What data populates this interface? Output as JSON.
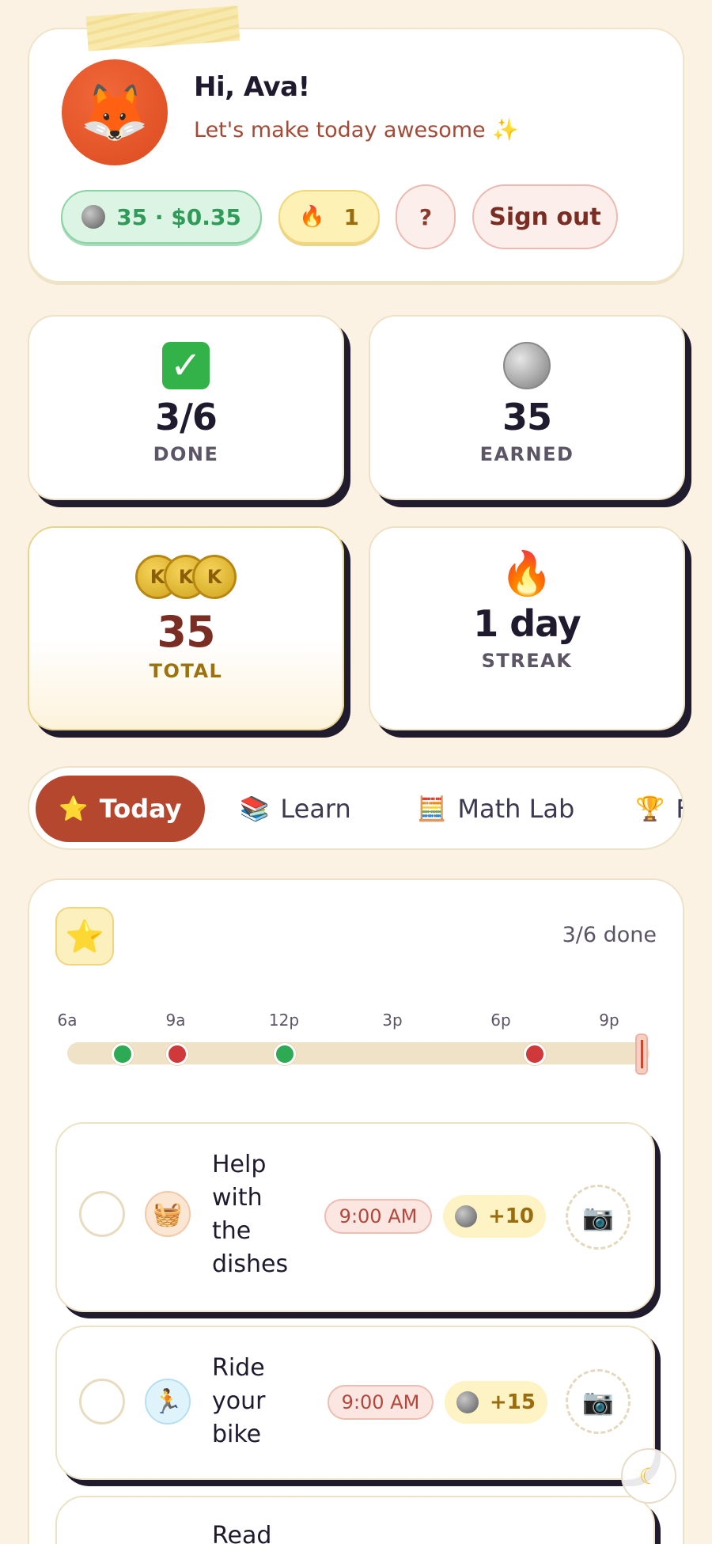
{
  "header": {
    "avatar_emoji": "🦊",
    "greeting": "Hi, Ava!",
    "subtitle": "Let's make today awesome ✨",
    "coins_pill": "35 · $0.35",
    "streak_pill_icon": "🔥",
    "streak_pill": "1",
    "help_label": "?",
    "signout_label": "Sign out"
  },
  "stats": {
    "done": {
      "value": "3/6",
      "label": "DONE"
    },
    "earned": {
      "value": "35",
      "label": "EARNED"
    },
    "total": {
      "value": "35",
      "label": "TOTAL",
      "coin_letters": [
        "K",
        "K",
        "K"
      ]
    },
    "streak": {
      "icon": "🔥",
      "value": "1 day",
      "label": "STREAK"
    }
  },
  "tabs": [
    {
      "icon": "⭐",
      "label": "Today",
      "active": true
    },
    {
      "icon": "📚",
      "label": "Learn"
    },
    {
      "icon": "🧮",
      "label": "Math Lab"
    },
    {
      "icon": "🏆",
      "label": "F"
    }
  ],
  "today": {
    "star_icon": "⭐",
    "progress": "3/6 done",
    "timeline_ticks": [
      "6a",
      "9a",
      "12p",
      "3p",
      "6p",
      "9p"
    ],
    "tasks": [
      {
        "icon": "🧺",
        "title_lines": [
          "Help",
          "with",
          "the",
          "dishes"
        ],
        "time": "9:00 AM",
        "reward": "+10",
        "camera": "📷"
      },
      {
        "icon": "🏃",
        "title_lines": [
          "Ride",
          "your",
          "bike"
        ],
        "time": "9:00 AM",
        "reward": "+15",
        "camera": "📷"
      },
      {
        "title_lines": [
          "Read"
        ]
      }
    ]
  },
  "colors": {
    "background": "#fbf2e4",
    "accent": "#b6472f",
    "success_green": "#2e9b58",
    "marker_green": "#2eaa55",
    "marker_red": "#d0393a"
  }
}
